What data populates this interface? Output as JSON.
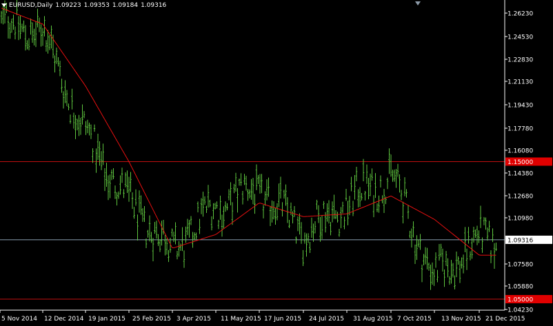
{
  "header": {
    "symbol": "EURUSD,Daily",
    "open": "1.09223",
    "high": "1.09353",
    "low": "1.09184",
    "close": "1.09316"
  },
  "colors": {
    "background": "#000000",
    "candles": "#5fc83f",
    "moving_average": "#e81010",
    "level_line": "#c21010",
    "level_label_bg": "#e00000",
    "current_price_line": "#8ca2b4",
    "axis": "#ffffff",
    "text": "#ffffff"
  },
  "price_axis": {
    "labels": [
      "1.26230",
      "1.24530",
      "1.22830",
      "1.21130",
      "1.19430",
      "1.17780",
      "1.16080",
      "1.14380",
      "1.12680",
      "1.10980",
      "1.07580",
      "1.05880",
      "1.04230"
    ]
  },
  "time_axis": {
    "labels": [
      "5 Nov 2014",
      "12 Dec 2014",
      "19 Jan 2015",
      "25 Feb 2015",
      "3 Apr 2015",
      "11 May 2015",
      "17 Jun 2015",
      "24 Jul 2015",
      "31 Aug 2015",
      "7 Oct 2015",
      "13 Nov 2015",
      "21 Dec 2015"
    ]
  },
  "levels": [
    {
      "price": 1.15,
      "label": "1.15000"
    },
    {
      "price": 1.05,
      "label": "1.05000"
    }
  ],
  "current_price": {
    "price": 1.09316,
    "label": "1.09316"
  },
  "chart_data": {
    "type": "line",
    "title": "EURUSD,Daily",
    "ylim": [
      1.042,
      1.2665
    ],
    "series": [
      {
        "x": [
          "5 Nov 2014",
          "12 Dec 2014",
          "19 Jan 2015",
          "25 Feb 2015",
          "3 Apr 2015",
          "11 May 2015",
          "17 Jun 2015",
          "24 Jul 2015",
          "31 Aug 2015",
          "7 Oct 2015",
          "13 Nov 2015",
          "21 Dec 2015"
        ],
        "values": [
          1.25,
          1.245,
          1.17,
          1.12,
          1.085,
          1.118,
          1.13,
          1.098,
          1.12,
          1.14,
          1.065,
          1.093
        ]
      },
      {
        "x": [
          "5 Nov 2014",
          "12 Dec 2014",
          "19 Jan 2015",
          "25 Feb 2015",
          "3 Apr 2015",
          "11 May 2015",
          "17 Jun 2015",
          "24 Jul 2015",
          "31 Aug 2015",
          "7 Oct 2015",
          "13 Nov 2015",
          "21 Dec 2015"
        ],
        "values": [
          1.262,
          1.25,
          1.205,
          1.15,
          1.087,
          1.097,
          1.12,
          1.11,
          1.112,
          1.125,
          1.108,
          1.082
        ]
      }
    ]
  }
}
